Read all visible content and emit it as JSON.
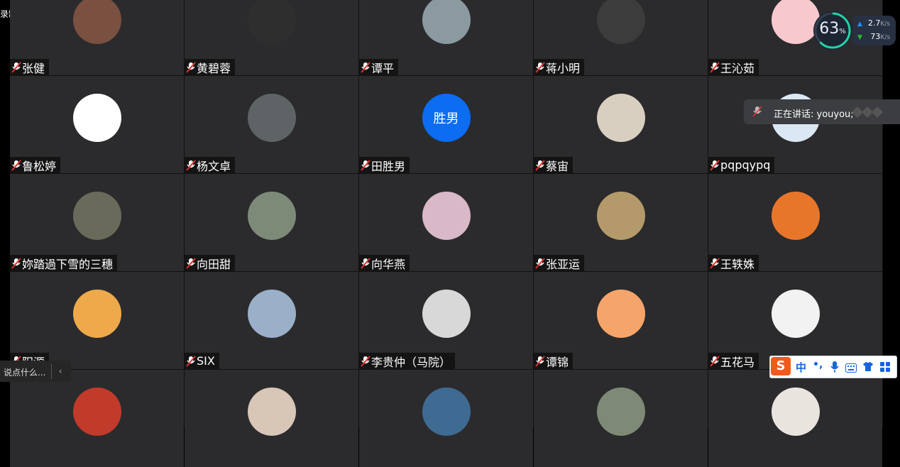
{
  "recording_label": "录制中",
  "participants": [
    {
      "name": "张健",
      "avatar_bg": "#7a5040"
    },
    {
      "name": "黄碧蓉",
      "avatar_bg": "#2e2e2e"
    },
    {
      "name": "谭平",
      "avatar_bg": "#8a9aa0"
    },
    {
      "name": "蒋小明",
      "avatar_bg": "#3c3c3c"
    },
    {
      "name": "王沁茹",
      "avatar_bg": "#f7c9cf"
    },
    {
      "name": "鲁松婷",
      "avatar_bg": "#ffffff"
    },
    {
      "name": "杨文卓",
      "avatar_bg": "#5e6466"
    },
    {
      "name": "田胜男",
      "avatar_bg": "#0c6cf2",
      "avatar_text": "胜男"
    },
    {
      "name": "蔡宙",
      "avatar_bg": "#d8cfc0"
    },
    {
      "name": "pqpqypq",
      "avatar_bg": "#dbe7f4"
    },
    {
      "name": "妳踏過下雪的三穗",
      "avatar_bg": "#6a6a5a"
    },
    {
      "name": "向田甜",
      "avatar_bg": "#7d8a78"
    },
    {
      "name": "向华燕",
      "avatar_bg": "#d9b8c8"
    },
    {
      "name": "张亚运",
      "avatar_bg": "#b49a6a"
    },
    {
      "name": "王轶姝",
      "avatar_bg": "#e8762a"
    },
    {
      "name": "阳源",
      "avatar_bg": "#eea94a"
    },
    {
      "name": "SIX",
      "avatar_bg": "#9ab0c8"
    },
    {
      "name": "李贵仲（马院）",
      "avatar_bg": "#d8d8d8"
    },
    {
      "name": "谭锦",
      "avatar_bg": "#f5a46a"
    },
    {
      "name": "五花马",
      "avatar_bg": "#f2f2f2"
    },
    {
      "name": "",
      "avatar_bg": "#c23a2a"
    },
    {
      "name": "",
      "avatar_bg": "#d8c6b6"
    },
    {
      "name": "",
      "avatar_bg": "#3f6a92"
    },
    {
      "name": "",
      "avatar_bg": "#7e8a76"
    },
    {
      "name": "",
      "avatar_bg": "#e9e4de"
    }
  ],
  "network": {
    "percent": "63",
    "percent_unit": "%",
    "upload": "2.7",
    "download": "73",
    "unit": "K/s",
    "upload_color": "#1e90ff",
    "download_color": "#2eb82e"
  },
  "speaking": {
    "text": "正在讲话: youyou;"
  },
  "chat": {
    "placeholder": "说点什么..."
  },
  "ime": {
    "mode": "中",
    "punct": "•,"
  }
}
